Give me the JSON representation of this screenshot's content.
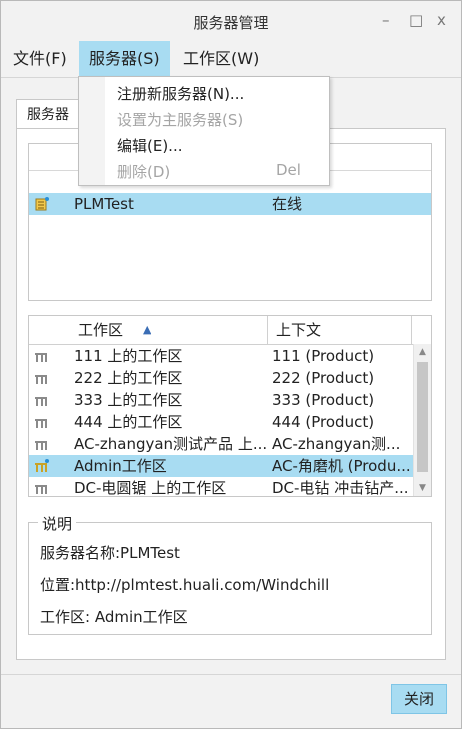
{
  "window": {
    "title": "服务器管理",
    "minimize_glyph": "–",
    "maximize_glyph": "□",
    "close_glyph": "x"
  },
  "menubar": {
    "file": "文件(F)",
    "server": "服务器(S)",
    "workspace": "工作区(W)"
  },
  "dropdown": {
    "items": [
      {
        "label": "注册新服务器(N)...",
        "enabled": true,
        "shortcut": ""
      },
      {
        "label": "设置为主服务器(S)",
        "enabled": false,
        "shortcut": ""
      },
      {
        "label": "编辑(E)...",
        "enabled": true,
        "shortcut": ""
      },
      {
        "label": "删除(D)",
        "enabled": false,
        "shortcut": "Del"
      }
    ]
  },
  "tab": {
    "label": "服务器"
  },
  "server_list": {
    "rows": [
      {
        "name": "PLMTest",
        "status": "在线",
        "icon": "server-primary-icon",
        "selected": true
      }
    ]
  },
  "workspace_table": {
    "columns": [
      "工作区",
      "上下文"
    ],
    "sort_indicator": "▲",
    "rows": [
      {
        "workspace": "111 上的工作区",
        "context": "111 (Product)",
        "selected": false
      },
      {
        "workspace": "222 上的工作区",
        "context": "222 (Product)",
        "selected": false
      },
      {
        "workspace": "333 上的工作区",
        "context": "333 (Product)",
        "selected": false
      },
      {
        "workspace": "444 上的工作区",
        "context": "444 (Product)",
        "selected": false
      },
      {
        "workspace": "AC-zhangyan测试产品 上...",
        "context": "AC-zhangyan测...",
        "selected": false
      },
      {
        "workspace": "Admin工作区",
        "context": "AC-角磨机 (Produ...",
        "selected": true
      },
      {
        "workspace": "DC-电圆锯 上的工作区",
        "context": "DC-电钻 冲击钻产...",
        "selected": false
      }
    ]
  },
  "description": {
    "title": "说明",
    "server_name": "服务器名称:PLMTest",
    "location": "位置:http://plmtest.huali.com/Windchill",
    "workspace": "工作区: Admin工作区"
  },
  "buttons": {
    "close": "关闭"
  },
  "colors": {
    "selection": "#a8dcf2",
    "background": "#f2f2f2",
    "disabled_text": "#a5a5a5"
  }
}
